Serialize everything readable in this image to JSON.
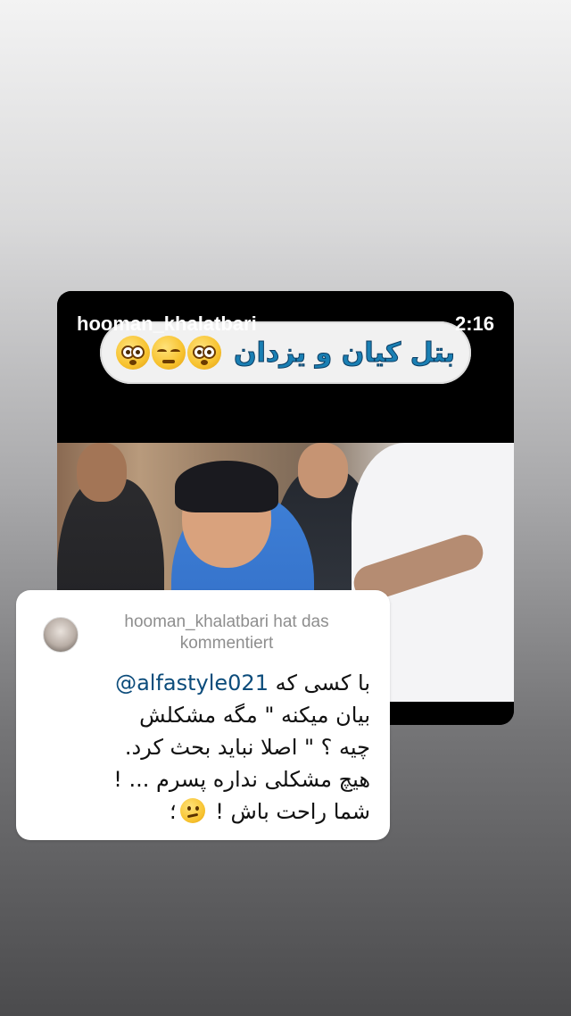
{
  "story": {
    "video": {
      "username": "hooman_khalatbari",
      "timestamp": "2:16",
      "caption": "بتل کیان و یزدان",
      "caption_emojis": [
        "flushed-face",
        "tired-face",
        "flushed-face"
      ]
    },
    "comment": {
      "author_line_1": "hooman_khalatbari hat das",
      "author_line_2": "kommentiert",
      "mention": "@alfastyle021",
      "text_line_1": "با کسی که",
      "text_line_2": "بیان میکنه \" مگه مشکلش",
      "text_line_3": "چیه ؟ \" اصلا نباید بحث کرد.",
      "text_line_4": "هیچ مشکلی نداره پسرم ... !",
      "text_line_5": "شما راحت باش !",
      "text_end": "؛",
      "emoji": "confused-face"
    }
  }
}
